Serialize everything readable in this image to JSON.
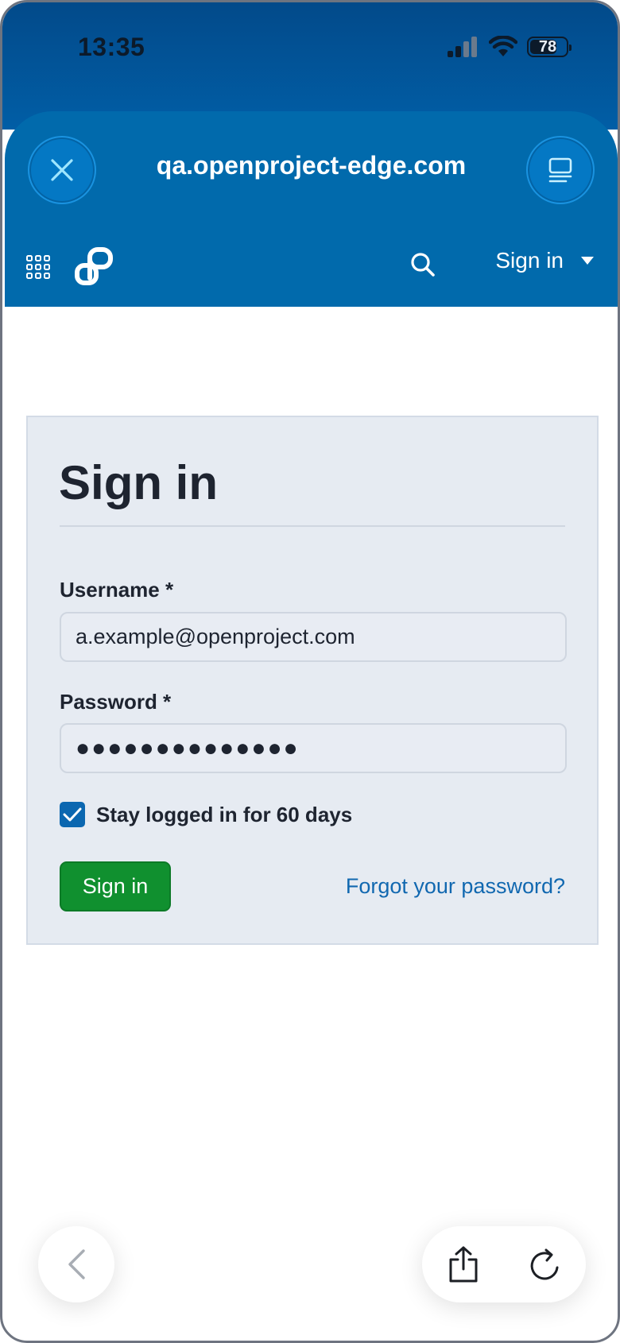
{
  "status_bar": {
    "time": "13:35",
    "battery_level": "78",
    "battery_fraction": 0.78,
    "icons": [
      "signal-icon",
      "wifi-icon",
      "battery-icon"
    ]
  },
  "browser": {
    "url": "qa.openproject-edge.com",
    "icons": [
      "close-icon",
      "reader-mode-icon",
      "back-arrow-icon",
      "share-icon",
      "reload-icon"
    ]
  },
  "app_nav": {
    "icons": [
      "app-grid-icon",
      "openproject-logo-icon",
      "search-icon",
      "caret-down-icon"
    ],
    "signin_label": "Sign in"
  },
  "login": {
    "title": "Sign in",
    "username_label": "Username *",
    "username_value": "a.example@openproject.com",
    "password_label": "Password *",
    "password_value": "●●●●●●●●●●●●●●",
    "remember_label": "Stay logged in for 60 days",
    "remember_checked": true,
    "submit_label": "Sign in",
    "forgot_link": "Forgot your password?"
  },
  "colors": {
    "brand_blue": "#016aac",
    "success_green": "#10902f",
    "link_blue": "#1168b0",
    "card_bg": "#e6ebf2"
  }
}
